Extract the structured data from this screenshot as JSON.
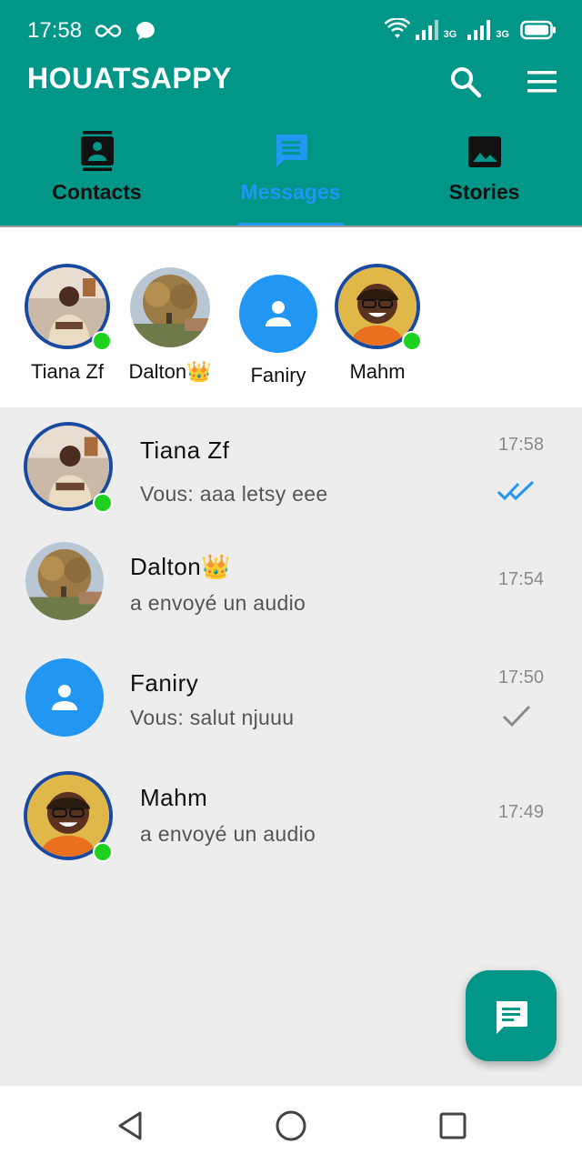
{
  "status_bar": {
    "time": "17:58",
    "network_label_1": "3G",
    "network_label_2": "3G"
  },
  "app_bar": {
    "title": "HOUATSAPPY",
    "search_icon": "search-icon",
    "menu_icon": "hamburger-menu-icon"
  },
  "tabs": [
    {
      "label": "Contacts",
      "icon": "contacts-icon",
      "active": false
    },
    {
      "label": "Messages",
      "icon": "message-icon",
      "active": true
    },
    {
      "label": "Stories",
      "icon": "image-icon",
      "active": false
    }
  ],
  "stories": [
    {
      "name": "Tiana Zf",
      "online": true,
      "avatar": "photo"
    },
    {
      "name": "Dalton👑",
      "online": false,
      "avatar": "tree-photo"
    },
    {
      "name": "Faniry",
      "online": false,
      "avatar": "default-person"
    },
    {
      "name": "Mahm",
      "online": true,
      "avatar": "photo"
    }
  ],
  "conversations": [
    {
      "name": "Tiana Zf",
      "preview": "Vous: aaa letsy eee",
      "time": "17:58",
      "status": "read-double-check",
      "online": true
    },
    {
      "name": "Dalton👑",
      "preview": "a envoyé un audio",
      "time": "17:54",
      "status": "none",
      "online": false
    },
    {
      "name": "Faniry",
      "preview": "Vous: salut njuuu",
      "time": "17:50",
      "status": "sent-check",
      "online": false
    },
    {
      "name": "Mahm",
      "preview": "a envoyé un audio",
      "time": "17:49",
      "status": "none",
      "online": true
    }
  ],
  "colors": {
    "primary": "#009688",
    "accent": "#2196f3",
    "online": "#1fd11f",
    "ring": "#1a4aa0"
  },
  "fab": {
    "icon": "new-message-icon"
  },
  "nav_bar": {
    "back_icon": "back-triangle-icon",
    "home_icon": "home-circle-icon",
    "recents_icon": "recents-square-icon"
  }
}
